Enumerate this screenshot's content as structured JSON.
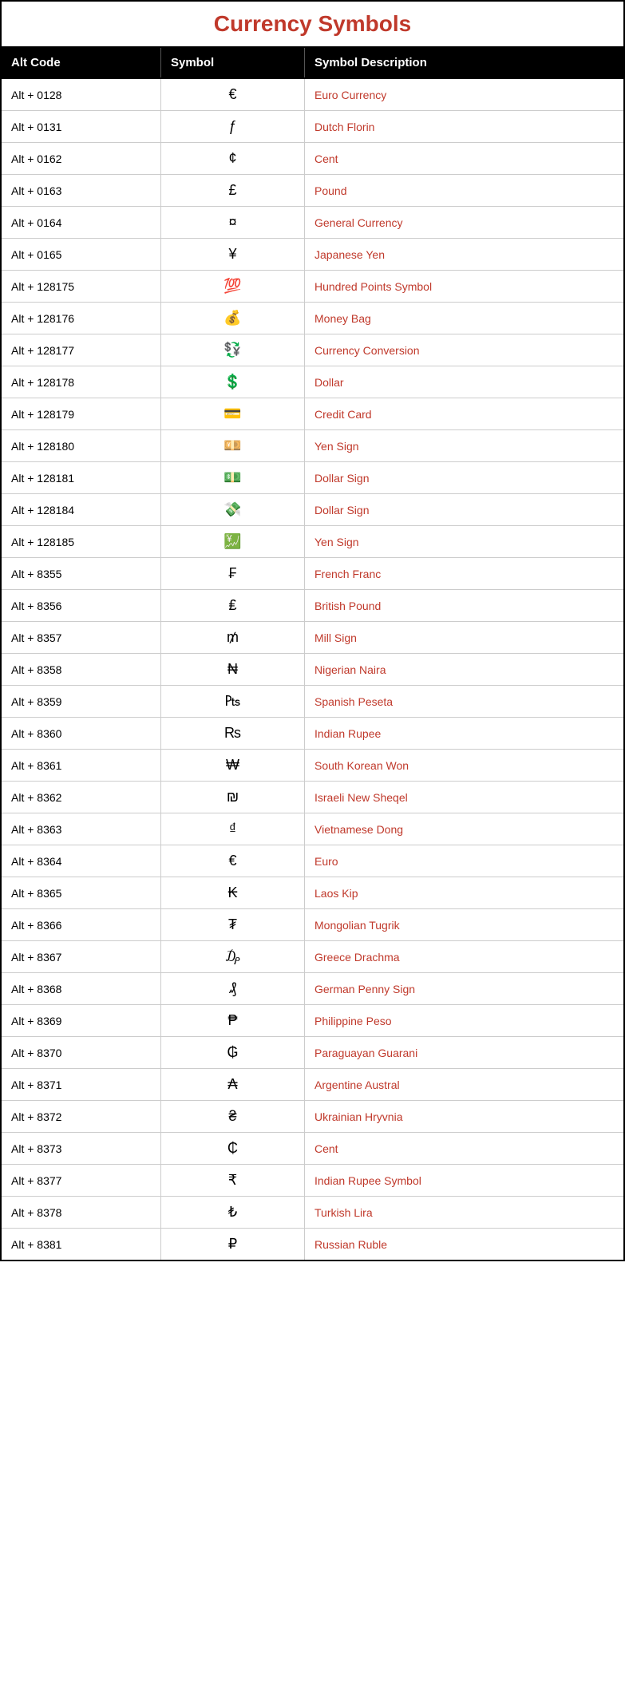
{
  "title": "Currency Symbols",
  "headers": [
    "Alt Code",
    "Symbol",
    "Symbol Description"
  ],
  "rows": [
    {
      "altcode": "Alt + 0128",
      "symbol": "€",
      "desc": "Euro Currency"
    },
    {
      "altcode": "Alt + 0131",
      "symbol": "ƒ",
      "desc": "Dutch Florin"
    },
    {
      "altcode": "Alt + 0162",
      "symbol": "¢",
      "desc": "Cent"
    },
    {
      "altcode": "Alt + 0163",
      "symbol": "£",
      "desc": "Pound"
    },
    {
      "altcode": "Alt + 0164",
      "symbol": "¤",
      "desc": "General Currency"
    },
    {
      "altcode": "Alt + 0165",
      "symbol": "¥",
      "desc": "Japanese Yen"
    },
    {
      "altcode": "Alt + 128175",
      "symbol": "💯",
      "desc": "Hundred Points Symbol"
    },
    {
      "altcode": "Alt + 128176",
      "symbol": "💰",
      "desc": "Money Bag"
    },
    {
      "altcode": "Alt + 128177",
      "symbol": "💱",
      "desc": "Currency Conversion"
    },
    {
      "altcode": "Alt + 128178",
      "symbol": "💲",
      "desc": "Dollar"
    },
    {
      "altcode": "Alt + 128179",
      "symbol": "💳",
      "desc": "Credit Card"
    },
    {
      "altcode": "Alt + 128180",
      "symbol": "💴",
      "desc": "Yen Sign"
    },
    {
      "altcode": "Alt + 128181",
      "symbol": "💵",
      "desc": "Dollar Sign"
    },
    {
      "altcode": "Alt + 128184",
      "symbol": "💸",
      "desc": "Dollar Sign"
    },
    {
      "altcode": "Alt + 128185",
      "symbol": "💹",
      "desc": "Yen Sign"
    },
    {
      "altcode": "Alt + 8355",
      "symbol": "₣",
      "desc": "French Franc"
    },
    {
      "altcode": "Alt + 8356",
      "symbol": "₤",
      "desc": "British Pound"
    },
    {
      "altcode": "Alt + 8357",
      "symbol": "₥",
      "desc": "Mill Sign"
    },
    {
      "altcode": "Alt + 8358",
      "symbol": "₦",
      "desc": "Nigerian Naira"
    },
    {
      "altcode": "Alt + 8359",
      "symbol": "₧",
      "desc": "Spanish Peseta"
    },
    {
      "altcode": "Alt + 8360",
      "symbol": "₨",
      "desc": "Indian Rupee"
    },
    {
      "altcode": "Alt + 8361",
      "symbol": "₩",
      "desc": "South Korean Won"
    },
    {
      "altcode": "Alt + 8362",
      "symbol": "₪",
      "desc": "Israeli New Sheqel"
    },
    {
      "altcode": "Alt + 8363",
      "symbol": "₫",
      "desc": "Vietnamese Dong"
    },
    {
      "altcode": "Alt + 8364",
      "symbol": "€",
      "desc": "Euro"
    },
    {
      "altcode": "Alt + 8365",
      "symbol": "₭",
      "desc": "Laos Kip"
    },
    {
      "altcode": "Alt + 8366",
      "symbol": "₮",
      "desc": "Mongolian Tugrik"
    },
    {
      "altcode": "Alt + 8367",
      "symbol": "₯",
      "desc": "Greece Drachma"
    },
    {
      "altcode": "Alt + 8368",
      "symbol": "₰",
      "desc": "German Penny  Sign"
    },
    {
      "altcode": "Alt + 8369",
      "symbol": "₱",
      "desc": "Philippine Peso"
    },
    {
      "altcode": "Alt + 8370",
      "symbol": "₲",
      "desc": "Paraguayan Guarani"
    },
    {
      "altcode": "Alt + 8371",
      "symbol": "₳",
      "desc": "Argentine Austral"
    },
    {
      "altcode": "Alt + 8372",
      "symbol": "₴",
      "desc": "Ukrainian Hryvnia"
    },
    {
      "altcode": "Alt + 8373",
      "symbol": "₵",
      "desc": "Cent"
    },
    {
      "altcode": "Alt + 8377",
      "symbol": "₹",
      "desc": "Indian Rupee Symbol"
    },
    {
      "altcode": "Alt + 8378",
      "symbol": "₺",
      "desc": "Turkish Lira"
    },
    {
      "altcode": "Alt + 8381",
      "symbol": "₽",
      "desc": "Russian Ruble"
    }
  ]
}
